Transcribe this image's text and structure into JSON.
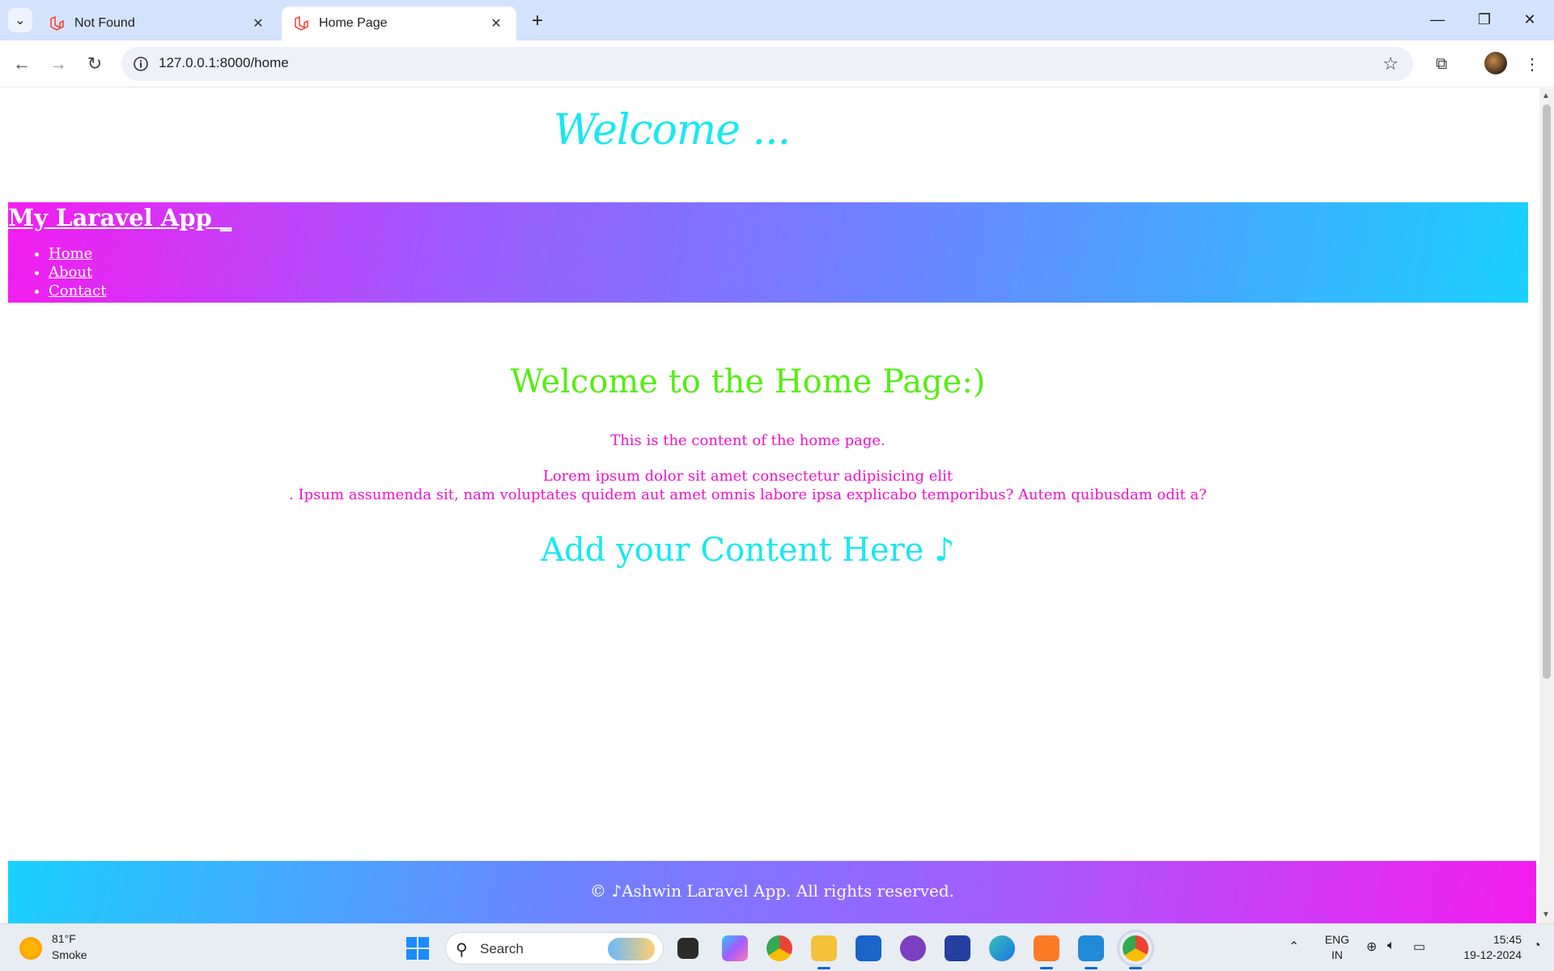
{
  "browser": {
    "tabs": [
      {
        "title": "Not Found"
      },
      {
        "title": "Home Page"
      }
    ],
    "url": "127.0.0.1:8000/home"
  },
  "page": {
    "top_welcome": "Welcome ...",
    "brand": "My Laravel App",
    "nav": [
      "Home",
      "About",
      "Contact"
    ],
    "home_title": "Welcome to the Home Page:)",
    "home_content": "This is the content of the home page.",
    "lorem_line1": "Lorem ipsum dolor sit amet consectetur adipisicing elit",
    "lorem_line2": ". Ipsum assumenda sit, nam voluptates quidem aut amet omnis labore ipsa explicabo temporibus? Autem quibusdam odit a?",
    "add_content": "Add your Content Here ♪",
    "footer": "© ♪Ashwin Laravel App. All rights reserved."
  },
  "taskbar": {
    "weather_temp": "81°F",
    "weather_desc": "Smoke",
    "search_label": "Search",
    "lang_1": "ENG",
    "lang_2": "IN",
    "time": "15:45",
    "date": "19-12-2024"
  },
  "colors": {
    "header_gradient": [
      "#f51cf0",
      "#1ad0ff"
    ],
    "green_heading": "#55ee11",
    "magenta_text": "#ee11cc",
    "cyan_text": "#18e8f0"
  }
}
